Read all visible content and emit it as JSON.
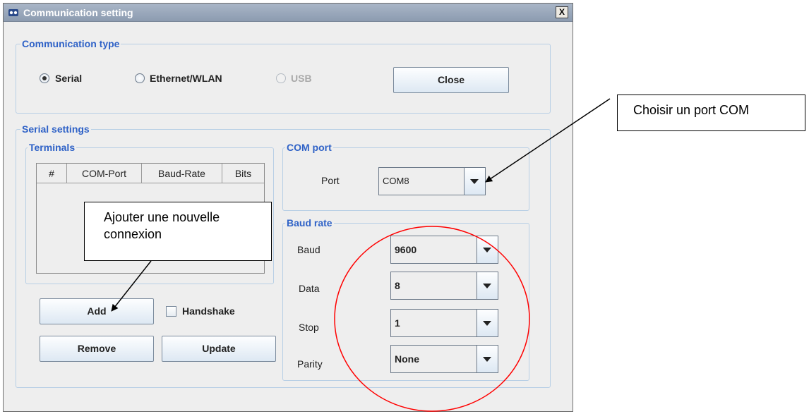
{
  "window": {
    "title": "Communication setting",
    "close_label": "X"
  },
  "communication_type": {
    "title": "Communication type",
    "options": [
      {
        "label": "Serial",
        "selected": true,
        "enabled": true
      },
      {
        "label": "Ethernet/WLAN",
        "selected": false,
        "enabled": true
      },
      {
        "label": "USB",
        "selected": false,
        "enabled": false
      }
    ],
    "close_button": "Close"
  },
  "serial_settings": {
    "title": "Serial settings",
    "terminals": {
      "title": "Terminals",
      "columns": [
        "#",
        "COM-Port",
        "Baud-Rate",
        "Bits"
      ],
      "rows": []
    },
    "com_port": {
      "title": "COM port",
      "port_label": "Port",
      "port_value": "COM8"
    },
    "baud_rate": {
      "title": "Baud rate",
      "fields": [
        {
          "label": "Baud",
          "value": "9600"
        },
        {
          "label": "Data",
          "value": "8"
        },
        {
          "label": "Stop",
          "value": "1"
        },
        {
          "label": "Parity",
          "value": "None"
        }
      ]
    },
    "buttons": {
      "add": "Add",
      "handshake": "Handshake",
      "handshake_checked": false,
      "remove": "Remove",
      "update": "Update"
    }
  },
  "annotations": {
    "choose_port": "Choisir un port COM",
    "add_connection_line1": "Ajouter une nouvelle",
    "add_connection_line2": "connexion",
    "highlight_color": "#ff0000"
  },
  "colors": {
    "group_title": "#2f62c7",
    "group_border": "#b8cfe5",
    "window_bg": "#eeeeee",
    "titlebar": "#9aa7ba"
  }
}
